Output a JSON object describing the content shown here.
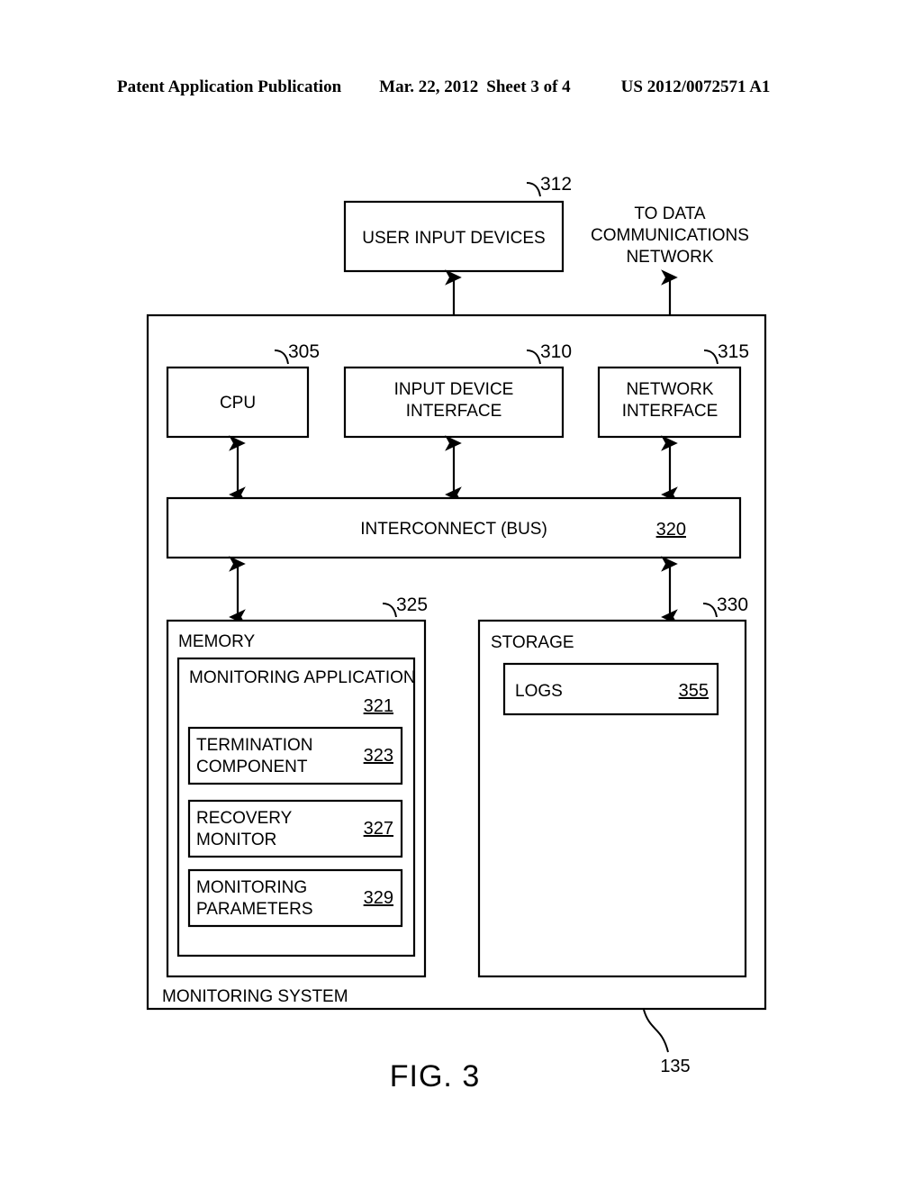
{
  "header": {
    "publication": "Patent Application Publication",
    "date": "Mar. 22, 2012",
    "sheet": "Sheet 3 of 4",
    "document_number": "US 2012/0072571 A1"
  },
  "figure": {
    "caption": "FIG. 3",
    "system_leader_ref": "135"
  },
  "external": {
    "user_input_devices": {
      "label": "USER INPUT DEVICES",
      "ref": "312"
    },
    "network_note": {
      "line1": "TO DATA",
      "line2": "COMMUNICATIONS",
      "line3": "NETWORK"
    }
  },
  "system": {
    "label": "MONITORING SYSTEM",
    "ref": "135"
  },
  "components": {
    "cpu": {
      "label": "CPU",
      "ref": "305"
    },
    "input_device_interface": {
      "line1": "INPUT DEVICE",
      "line2": "INTERFACE",
      "ref": "310"
    },
    "network_interface": {
      "line1": "NETWORK",
      "line2": "INTERFACE",
      "ref": "315"
    },
    "interconnect": {
      "label": "INTERCONNECT (BUS)",
      "ref": "320"
    },
    "memory": {
      "label": "MEMORY",
      "ref": "325"
    },
    "storage": {
      "label": "STORAGE",
      "ref": "330"
    },
    "monitoring_application": {
      "label": "MONITORING APPLICATION",
      "ref": "321"
    },
    "termination_component": {
      "line1": "TERMINATION",
      "line2": "COMPONENT",
      "ref": "323"
    },
    "recovery_monitor": {
      "line1": "RECOVERY",
      "line2": "MONITOR",
      "ref": "327"
    },
    "monitoring_parameters": {
      "line1": "MONITORING",
      "line2": "PARAMETERS",
      "ref": "329"
    },
    "logs": {
      "label": "LOGS",
      "ref": "355"
    }
  },
  "colors": {
    "ink": "#000000",
    "paper": "#ffffff"
  }
}
